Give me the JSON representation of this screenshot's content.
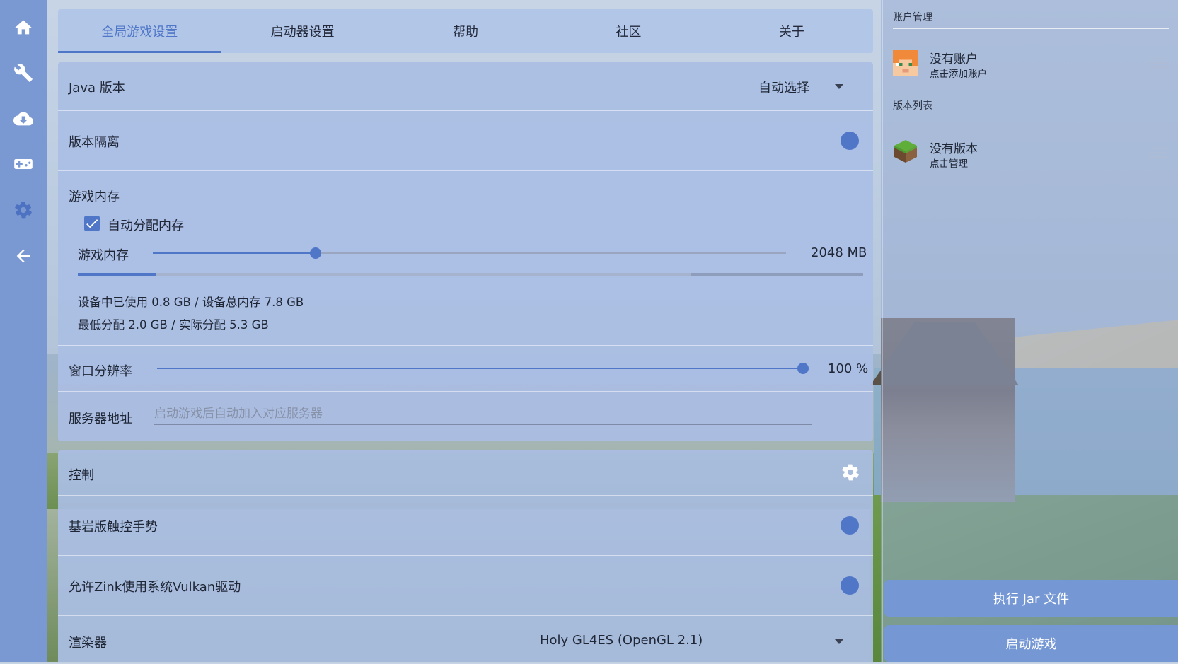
{
  "tabs": [
    "全局游戏设置",
    "启动器设置",
    "帮助",
    "社区",
    "关于"
  ],
  "settings": {
    "java_label": "Java 版本",
    "java_value": "自动选择",
    "isolation_label": "版本隔离",
    "memory_section": "游戏内存",
    "auto_memory_label": "自动分配内存",
    "auto_memory_checked": true,
    "memory_label": "游戏内存",
    "memory_value": "2048 MB",
    "memory_slider_fraction": 0.257,
    "memory_bar": {
      "used_fraction": 0.1,
      "alloc_fraction": 0.78
    },
    "device_info": "设备中已使用 0.8 GB / 设备总内存 7.8 GB",
    "alloc_info": "最低分配 2.0 GB / 实际分配 5.3 GB",
    "resolution_label": "窗口分辨率",
    "resolution_value": "100 %",
    "resolution_fraction": 1.0,
    "server_label": "服务器地址",
    "server_placeholder": "启动游戏后自动加入对应服务器",
    "server_value": ""
  },
  "controls": {
    "control_label": "控制",
    "bedrock_label": "基岩版触控手势",
    "zink_label": "允许Zink使用系统Vulkan驱动",
    "renderer_label": "渲染器",
    "renderer_value": "Holy GL4ES (OpenGL 2.1)"
  },
  "side": {
    "account_section": "账户管理",
    "account_title": "没有账户",
    "account_sub": "点击添加账户",
    "version_section": "版本列表",
    "version_title": "没有版本",
    "version_sub": "点击管理",
    "run_jar": "执行 Jar 文件",
    "launch": "启动游戏"
  },
  "rail_icons": [
    "home-icon",
    "wrench-icon",
    "cloud-download-icon",
    "gamepad-icon",
    "gear-icon",
    "back-arrow-icon"
  ],
  "colors": {
    "accent": "#4f76c7",
    "rail": "#7a99d3",
    "button": "#7597d4"
  }
}
